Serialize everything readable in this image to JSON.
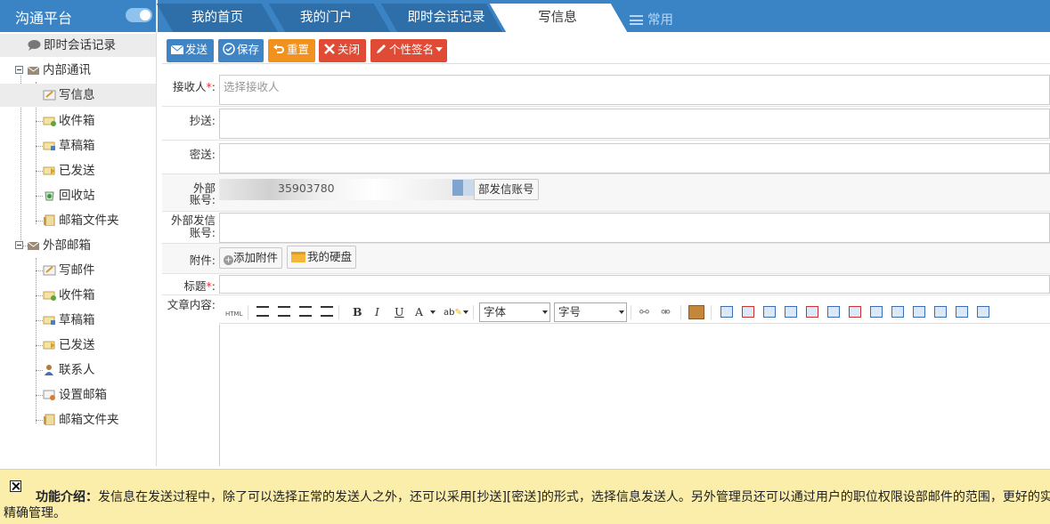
{
  "sidebar": {
    "title": "沟通平台",
    "items": [
      {
        "label": "即时会话记录",
        "icon": "chat-bubble-icon"
      },
      {
        "label": "内部通讯",
        "icon": "mailbox-icon"
      },
      {
        "label": "写信息",
        "icon": "write-message-icon"
      },
      {
        "label": "收件箱",
        "icon": "inbox-icon"
      },
      {
        "label": "草稿箱",
        "icon": "drafts-icon"
      },
      {
        "label": "已发送",
        "icon": "sent-icon"
      },
      {
        "label": "回收站",
        "icon": "recycle-bin-icon"
      },
      {
        "label": "邮箱文件夹",
        "icon": "folder-icon"
      },
      {
        "label": "外部邮箱",
        "icon": "mailbox-icon"
      },
      {
        "label": "写邮件",
        "icon": "write-mail-icon"
      },
      {
        "label": "收件箱",
        "icon": "inbox-icon"
      },
      {
        "label": "草稿箱",
        "icon": "drafts-icon"
      },
      {
        "label": "已发送",
        "icon": "sent-icon"
      },
      {
        "label": "联系人",
        "icon": "contacts-icon"
      },
      {
        "label": "设置邮箱",
        "icon": "settings-mail-icon"
      },
      {
        "label": "邮箱文件夹",
        "icon": "folder-icon"
      }
    ]
  },
  "tabs": [
    {
      "label": "我的首页"
    },
    {
      "label": "我的门户"
    },
    {
      "label": "即时会话记录"
    },
    {
      "label": "写信息",
      "active": true
    },
    {
      "label": "常用"
    }
  ],
  "toolbar": {
    "send": "发送",
    "save": "保存",
    "reset": "重置",
    "close": "关闭",
    "signature": "个性签名"
  },
  "form": {
    "recipient_label": "接收人",
    "recipient_required": "*",
    "recipient_placeholder": "选择接收人",
    "cc_label": "抄送:",
    "bcc_label": "密送:",
    "ext_account_label_1": "外部",
    "ext_account_label_2": "账号:",
    "ext_account_partial": "35903780",
    "ext_account_button": "部发信账号",
    "ext_sender_label": "外部发信账号:",
    "attachment_label": "附件:",
    "add_attachment": "添加附件",
    "my_disk": "我的硬盘",
    "subject_label": "标题",
    "subject_required": "*",
    "content_label": "文章内容:"
  },
  "editor": {
    "html": "HTML",
    "bold": "B",
    "italic": "I",
    "underline": "U",
    "font_color": "A",
    "font_select": "字体",
    "size_select": "字号"
  },
  "footer": {
    "heading": "功能介绍：",
    "text": "发信息在发送过程中，除了可以选择正常的发送人之外，还可以采用[抄送][密送]的形式，选择信息发送人。另外管理员还可以通过用户的职位权限设部邮件的范围，更好的实现精确管理。"
  },
  "colors": {
    "primary": "#3a84c6",
    "send": "#3f84c5",
    "save": "#3f84c5",
    "reset": "#f0921d",
    "close": "#e04b35",
    "signature": "#e04b35",
    "footer_bg": "#fbedaa"
  }
}
